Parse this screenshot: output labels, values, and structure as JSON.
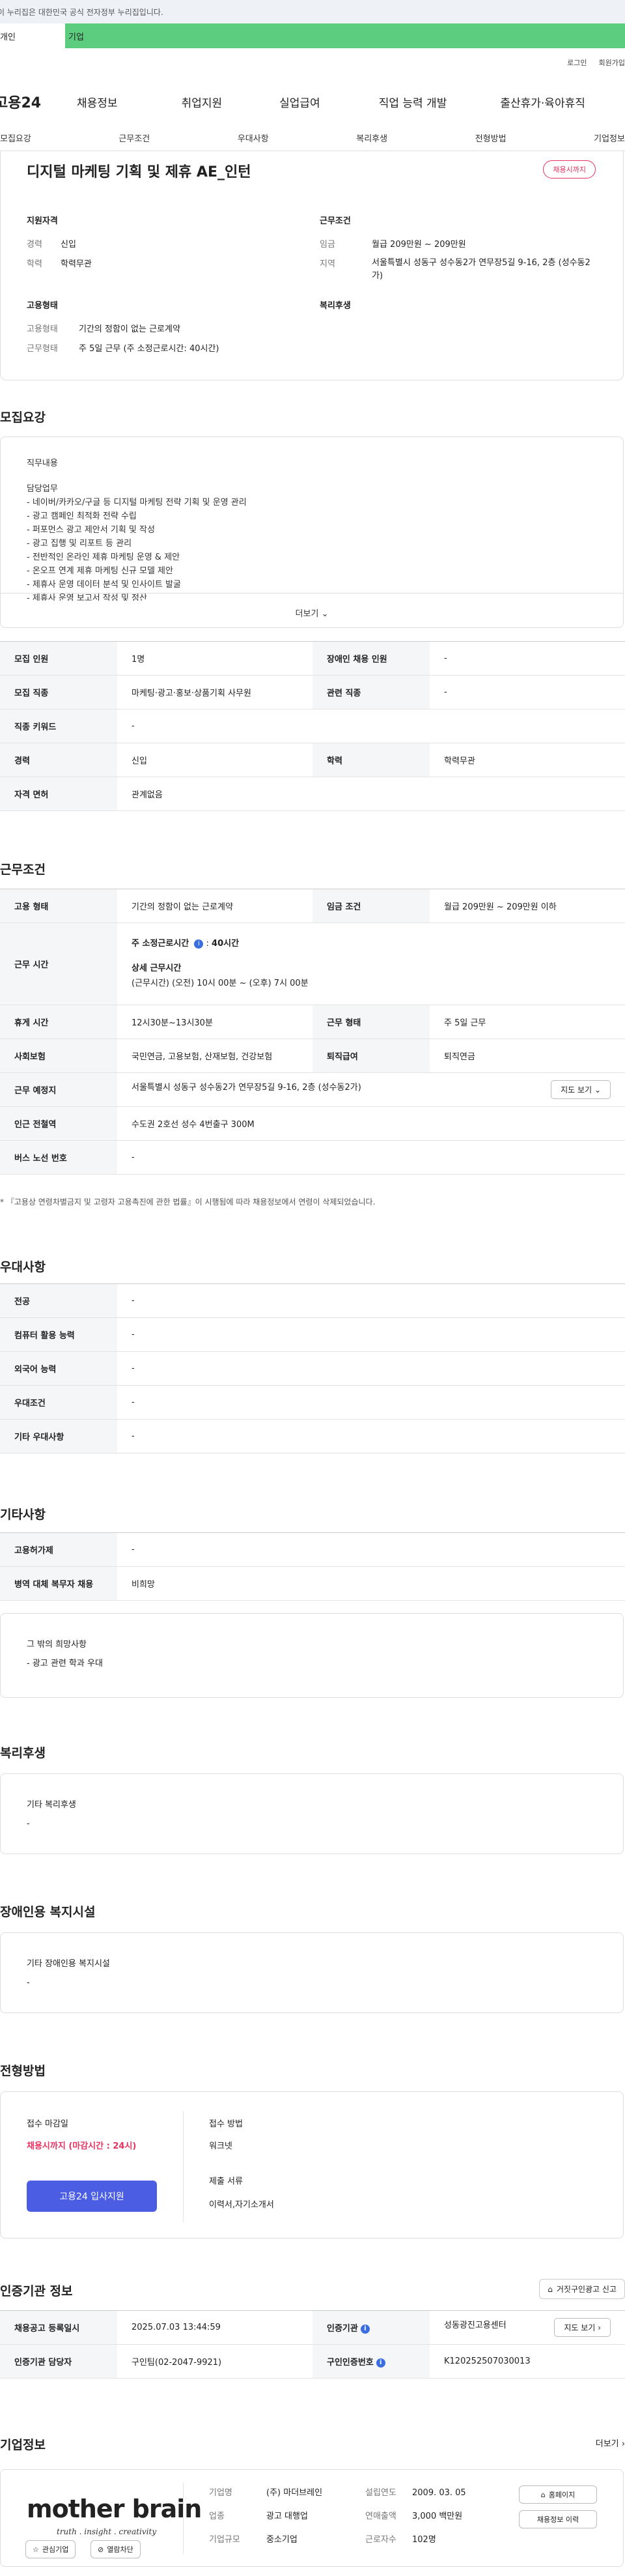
{
  "gov_bar": {
    "text": "이 누리집은 대한민국 공식 전자정부 누리집입니다."
  },
  "tabs": [
    {
      "label": "개인"
    },
    {
      "label": "기업"
    }
  ],
  "util": {
    "login": "로그인",
    "signup": "회원가입"
  },
  "gnb": {
    "logo": "고용24",
    "items": [
      "채용정보",
      "취업지원",
      "실업급여",
      "직업 능력 개발",
      "출산휴가·육아휴직"
    ]
  },
  "subnav": [
    "모집요강",
    "근무조건",
    "우대사항",
    "복리후생",
    "전형방법",
    "기업정보"
  ],
  "summary": {
    "title": "디지털 마케팅 기획 및 제휴 AE_인턴",
    "badge": "채용시까지",
    "qual_head": "지원자격",
    "career_k": "경력",
    "career_v": "신입",
    "edu_k": "학력",
    "edu_v": "학력무관",
    "work_head": "근무조건",
    "wage_k": "임금",
    "wage_v": "월급 209만원 ~ 209만원",
    "area_k": "지역",
    "area_v": "서울특별시 성동구 성수동2가 연무장5길 9-16, 2층 (성수동2가)",
    "emp_head": "고용형태",
    "type_k": "고용형태",
    "type_v": "기간의 정함이 없는 근로계약",
    "form_k": "근무형태",
    "form_v": "주 5일 근무 (주 소정근로시간: 40시간)",
    "welfare_head": "복리후생"
  },
  "recruit": {
    "section_title": "모집요강",
    "duty_head": "직무내용",
    "duty_lines": [
      "담당업무",
      "- 네이버/카카오/구글 등 디지털 마케팅 전략 기획 및 운영 관리",
      "- 광고 캠페인 최적화 전략 수립",
      "- 퍼포먼스 광고 제안서 기획 및 작성",
      "- 광고 집행 및 리포트 등 관리",
      "- 전반적인 온라인 제휴 마케팅 운영 & 제안",
      "- 온오프 연계 제휴 마케팅 신규 모델 제안",
      "- 제휴사 운영 데이터 분석 및 인사이트 발굴",
      "- 제휴사 운영 보고서 작성 및 정산"
    ],
    "more": "더보기",
    "rows": [
      [
        {
          "k": "모집 인원",
          "v": "1명"
        },
        {
          "k": "장애인 채용 인원",
          "v": "-"
        }
      ],
      [
        {
          "k": "모집 직종",
          "v": "마케팅·광고·홍보·상품기획 사무원"
        },
        {
          "k": "관련 직종",
          "v": "-"
        }
      ],
      [
        {
          "k": "직종 키워드",
          "v": "-"
        }
      ],
      [
        {
          "k": "경력",
          "v": "신입"
        },
        {
          "k": "학력",
          "v": "학력무관"
        }
      ],
      [
        {
          "k": "자격 면허",
          "v": "관계없음"
        }
      ]
    ]
  },
  "work": {
    "section_title": "근무조건",
    "emp_type_k": "고용 형태",
    "emp_type_v": "기간의 정함이 없는 근로계약",
    "wage_k": "임금 조건",
    "wage_v": "월급 209만원 ~ 209만원 이하",
    "hours_k": "근무 시간",
    "hours_main": "주 소정근로시간",
    "hours_value": "40시간",
    "hours_detail_h": "상세 근무시간",
    "hours_detail_v": "(근무시간) (오전) 10시 00분 ~ (오후) 7시 00분",
    "rest_k": "휴게 시간",
    "rest_v": "12시30분~13시30분",
    "form_k": "근무 형태",
    "form_v": "주 5일 근무",
    "insurance_k": "사회보험",
    "insurance_v": "국민연금, 고용보험, 산재보험, 건강보험",
    "retire_k": "퇴직급여",
    "retire_v": "퇴직연금",
    "place_k": "근무 예정지",
    "place_v": "서울특별시 성동구 성수동2가 연무장5길 9-16, 2층 (성수동2가)",
    "map_btn": "지도 보기",
    "subway_k": "인근 전철역",
    "subway_v": "수도권 2호선 성수 4번출구 300M",
    "bus_k": "버스 노선 번호",
    "bus_v": "-",
    "note": "* 『고용상 연령차별금지 및 고령자 고용촉진에 관한 법률』이 시행됨에 따라 채용정보에서 연령이 삭제되었습니다."
  },
  "prefer": {
    "section_title": "우대사항",
    "rows": [
      {
        "k": "전공",
        "v": "-"
      },
      {
        "k": "컴퓨터 활용 능력",
        "v": "-"
      },
      {
        "k": "외국어 능력",
        "v": "-"
      },
      {
        "k": "우대조건",
        "v": "-"
      },
      {
        "k": "기타 우대사항",
        "v": "-"
      }
    ]
  },
  "etc": {
    "section_title": "기타사항",
    "rows": [
      {
        "k": "고용허가제",
        "v": "-"
      },
      {
        "k": "병역 대체 복무자 채용",
        "v": "비희망"
      }
    ],
    "wish_head": "그 밖의 희망사항",
    "wish_v": "- 광고 관련 학과 우대"
  },
  "welfare": {
    "section_title": "복리후생",
    "head": "기타 복리후생",
    "v": "-"
  },
  "disabled": {
    "section_title": "장애인용 복지시설",
    "head": "기타 장애인용 복지시설",
    "v": "-"
  },
  "apply": {
    "section_title": "전형방법",
    "deadline_h": "접수 마감일",
    "deadline_v": "채용시까지 (마감시간 : 24시)",
    "apply_btn": "고용24 입사지원",
    "method_h": "접수 방법",
    "method_v": "워크넷",
    "docs_h": "제출 서류",
    "docs_v": "이력서,자기소개서"
  },
  "org": {
    "section_title": "인증기관 정보",
    "report_btn": "거짓구인광고 신고",
    "reg_k": "채용공고 등록일시",
    "reg_v": "2025.07.03 13:44:59",
    "agency_k": "인증기관",
    "agency_v": "성동광진고용센터",
    "map_btn": "지도 보기",
    "manager_k": "인증기관 담당자",
    "manager_v": "구인팀(02-2047-9921)",
    "num_k": "구인인증번호",
    "num_v": "K120252507030013"
  },
  "company": {
    "section_title": "기업정보",
    "more": "더보기",
    "logo_text": "mother brain",
    "logo_tag": "truth . insight . creativity",
    "fav_btn": "관심기업",
    "block_btn": "열람차단",
    "name_k": "기업명",
    "name_v": "(주) 마더브레인",
    "founded_k": "설립연도",
    "founded_v": "2009. 03. 05",
    "industry_k": "업종",
    "industry_v": "광고 대행업",
    "sales_k": "연매출액",
    "sales_v": "3,000 백만원",
    "scale_k": "기업규모",
    "scale_v": "중소기업",
    "emp_k": "근로자수",
    "emp_v": "102명",
    "home_btn": "홈페이지",
    "history_btn": "채용정보 이력"
  }
}
